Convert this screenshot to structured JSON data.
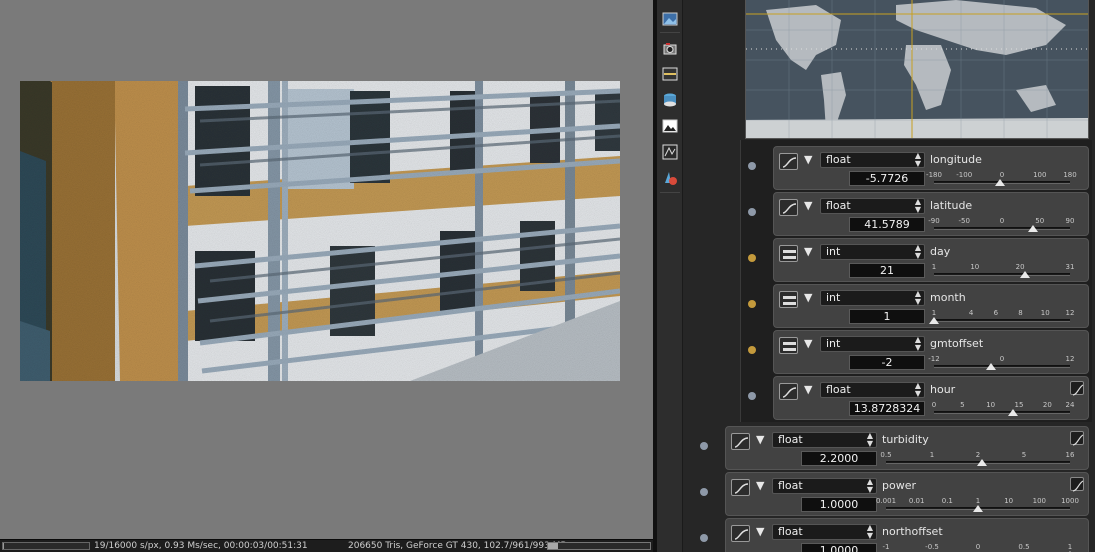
{
  "status": {
    "samples": "19/16000 s/px, 0.93 Ms/sec, 00:00:03/00:51:31",
    "gpu": "206650 Tris, GeForce GT 430, 102.7/961/993 MB",
    "render_progress": 0.0012,
    "memory_usage": 0.1
  },
  "toolbar": {
    "items": [
      "image-icon",
      "camera-icon",
      "environment-icon",
      "texture-stack-icon",
      "picture-icon",
      "render-settings-icon",
      "material-icon"
    ]
  },
  "params": [
    {
      "name": "longitude",
      "type": "float",
      "value": "-5.7726",
      "kind": "float",
      "ticks": [
        "-180",
        "-100",
        "0",
        "100",
        "180"
      ],
      "range": [
        -180,
        180
      ],
      "level": -5.7726,
      "curve": false
    },
    {
      "name": "latitude",
      "type": "float",
      "value": "41.5789",
      "kind": "float",
      "ticks": [
        "-90",
        "-50",
        "0",
        "50",
        "90"
      ],
      "range": [
        -90,
        90
      ],
      "level": 41.5789,
      "curve": false
    },
    {
      "name": "day",
      "type": "int",
      "value": "21",
      "kind": "int",
      "ticks": [
        "1",
        "10",
        "20",
        "31"
      ],
      "range": [
        1,
        31
      ],
      "level": 21,
      "curve": false
    },
    {
      "name": "month",
      "type": "int",
      "value": "1",
      "kind": "int",
      "ticks": [
        "1",
        "4",
        "6",
        "8",
        "10",
        "12"
      ],
      "range": [
        1,
        12
      ],
      "level": 1,
      "curve": false
    },
    {
      "name": "gmtoffset",
      "type": "int",
      "value": "-2",
      "kind": "int",
      "ticks": [
        "-12",
        "0",
        "12"
      ],
      "range": [
        -12,
        12
      ],
      "level": -2,
      "curve": false
    },
    {
      "name": "hour",
      "type": "float",
      "value": "13.8728324",
      "kind": "float",
      "ticks": [
        "0",
        "5",
        "10",
        "15",
        "20",
        "24"
      ],
      "range": [
        0,
        24
      ],
      "level": 13.8728324,
      "curve": true
    },
    {
      "name": "turbidity",
      "type": "float",
      "value": "2.2000",
      "kind": "float",
      "ticks": [
        "0.5",
        "1",
        "2",
        "5",
        "16"
      ],
      "range": [
        0.5,
        16
      ],
      "level": 2.2,
      "curve": true
    },
    {
      "name": "power",
      "type": "float",
      "value": "1.0000",
      "kind": "float",
      "ticks": [
        "0.001",
        "0.01",
        "0.1",
        "1",
        "10",
        "100",
        "1000"
      ],
      "range": [
        0.001,
        1000
      ],
      "level": 1.0,
      "curve": true
    },
    {
      "name": "northoffset",
      "type": "float",
      "value": "1.0000",
      "kind": "float",
      "ticks": [
        "-1",
        "-0.5",
        "0",
        "0.5",
        "1"
      ],
      "range": [
        -1,
        1
      ],
      "level": 1.0,
      "curve": false
    }
  ]
}
